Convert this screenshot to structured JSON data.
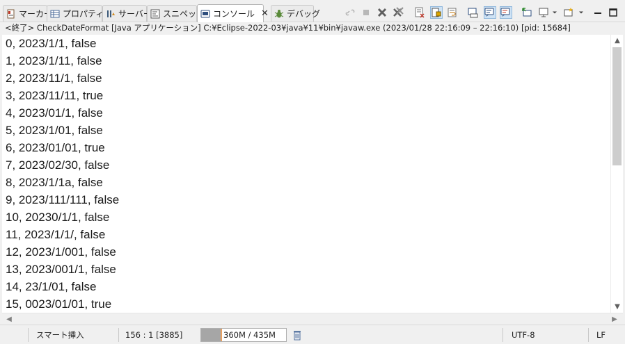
{
  "tabs": [
    {
      "label": "マーカー",
      "icon": "markers-icon"
    },
    {
      "label": "プロパティー",
      "icon": "properties-icon"
    },
    {
      "label": "サーバー",
      "icon": "servers-icon"
    },
    {
      "label": "スニペット",
      "icon": "snippets-icon"
    },
    {
      "label": "コンソール",
      "icon": "console-icon",
      "active": true
    },
    {
      "label": "デバッグ",
      "icon": "debug-icon"
    }
  ],
  "toolbar": {
    "icons": [
      "link-icon",
      "stop-icon",
      "remove-launch-icon",
      "remove-all-icon",
      "clear-console-icon",
      "scroll-lock-icon",
      "word-wrap-icon",
      "show-on-stdout-icon",
      "show-on-stderr-icon",
      "pin-console-icon",
      "display-console-icon",
      "new-console-icon",
      "minimize-icon",
      "maximize-icon"
    ]
  },
  "console": {
    "header": "<終了> CheckDateFormat [Java アプリケーション] C:¥Eclipse-2022-03¥java¥11¥bin¥javaw.exe  (2023/01/28 22:16:09 – 22:16:10) [pid: 15684]",
    "lines": [
      "0, 2023/1/1, false",
      "1, 2023/1/11, false",
      "2, 2023/11/1, false",
      "3, 2023/11/11, true",
      "4, 2023/01/1, false",
      "5, 2023/1/01, false",
      "6, 2023/01/01, true",
      "7, 2023/02/30, false",
      "8, 2023/1/1a, false",
      "9, 2023/111/111, false",
      "10, 20230/1/1, false",
      "11, 2023/1/1/, false",
      "12, 2023/1/001, false",
      "13, 2023/001/1, false",
      "14, 23/1/01, false",
      "15, 0023/01/01, true"
    ]
  },
  "statusbar": {
    "insert_mode": "スマート挿入",
    "position": "156 : 1 [3885]",
    "heap": "360M / 435M",
    "heap_used_fraction": 0.83,
    "encoding": "UTF-8",
    "line_delimiter": "LF"
  }
}
